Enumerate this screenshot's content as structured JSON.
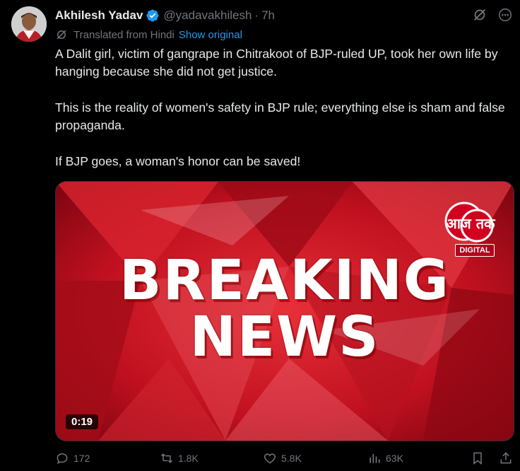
{
  "author": {
    "name": "Akhilesh Yadav",
    "handle": "@yadavakhilesh",
    "separator": "·",
    "time": "7h"
  },
  "translation": {
    "label": "Translated from Hindi",
    "link": "Show original"
  },
  "tweet": {
    "paragraphs": [
      "A Dalit girl, victim of gangrape in Chitrakoot of BJP-ruled UP, took her own life by hanging because she did not get justice.",
      "This is the reality of women's safety in BJP rule; everything else is sham and false propaganda.",
      "If BJP goes, a woman's honor can be saved!"
    ]
  },
  "media": {
    "headline_line1": "BREAKING",
    "headline_line2": "NEWS",
    "logo_text": "आज तक",
    "logo_badge": "DIGITAL",
    "duration": "0:19"
  },
  "actions": {
    "replies": "172",
    "reposts": "1.8K",
    "likes": "5.8K",
    "views": "63K"
  },
  "colors": {
    "background": "#000000",
    "text": "#e7e9ea",
    "muted": "#71767b",
    "link": "#1d9bf0",
    "verified": "#1d9bf0",
    "media_red": "#c0101f"
  },
  "icons": {
    "verified": "verified-badge-icon",
    "grok": "grok-icon",
    "more": "more-icon",
    "translate": "translate-icon",
    "reply": "reply-icon",
    "repost": "repost-icon",
    "like": "heart-icon",
    "views": "views-icon",
    "bookmark": "bookmark-icon",
    "share": "share-icon"
  }
}
